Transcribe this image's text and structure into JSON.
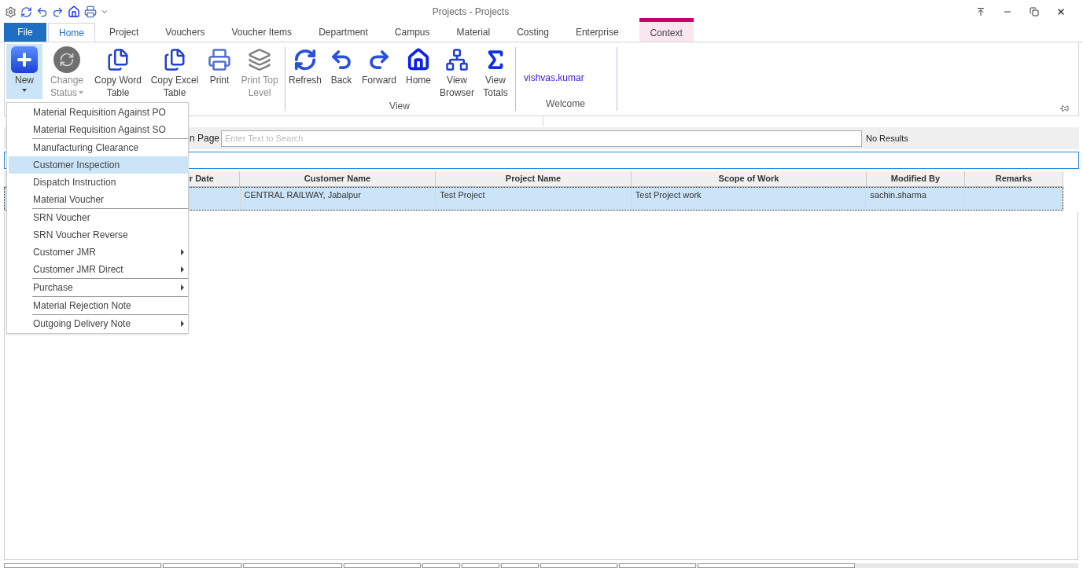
{
  "window": {
    "title": "Projects - Projects"
  },
  "tabs": [
    {
      "label": "File",
      "kind": "file",
      "selected": false
    },
    {
      "label": "Home",
      "kind": "tab",
      "selected": true
    },
    {
      "label": "Project",
      "kind": "tab",
      "selected": false
    },
    {
      "label": "Vouchers",
      "kind": "tab",
      "selected": false
    },
    {
      "label": "Voucher Items",
      "kind": "tab",
      "selected": false
    },
    {
      "label": "Department",
      "kind": "tab",
      "selected": false
    },
    {
      "label": "Campus",
      "kind": "tab",
      "selected": false
    },
    {
      "label": "Material",
      "kind": "tab",
      "selected": false
    },
    {
      "label": "Costing",
      "kind": "tab",
      "selected": false
    },
    {
      "label": "Enterprise",
      "kind": "tab",
      "selected": false
    },
    {
      "label": "Context",
      "kind": "context",
      "selected": false
    }
  ],
  "ribbon": {
    "groups": [
      {
        "buttons": [
          {
            "lines": [
              "New"
            ],
            "pressed": true,
            "disabled": false,
            "dropdown": true
          },
          {
            "lines": [
              "Change",
              "Status"
            ],
            "pressed": false,
            "disabled": true,
            "dropdown": true
          },
          {
            "lines": [
              "Copy Word",
              "Table"
            ],
            "pressed": false,
            "disabled": false,
            "dropdown": false
          },
          {
            "lines": [
              "Copy Excel",
              "Table"
            ],
            "pressed": false,
            "disabled": false,
            "dropdown": false
          },
          {
            "lines": [
              "Print"
            ],
            "pressed": false,
            "disabled": false,
            "dropdown": false
          },
          {
            "lines": [
              "Print Top",
              "Level"
            ],
            "pressed": false,
            "disabled": true,
            "dropdown": false
          }
        ]
      },
      {
        "label": "View",
        "buttons": [
          {
            "lines": [
              "Refresh"
            ],
            "pressed": false,
            "disabled": false,
            "dropdown": false
          },
          {
            "lines": [
              "Back"
            ],
            "pressed": false,
            "disabled": false,
            "dropdown": false
          },
          {
            "lines": [
              "Forward"
            ],
            "pressed": false,
            "disabled": false,
            "dropdown": false
          },
          {
            "lines": [
              "Home"
            ],
            "pressed": false,
            "disabled": false,
            "dropdown": false
          },
          {
            "lines": [
              "View",
              "Browser"
            ],
            "pressed": false,
            "disabled": false,
            "dropdown": false
          },
          {
            "lines": [
              "View",
              "Totals"
            ],
            "pressed": false,
            "disabled": false,
            "dropdown": false
          }
        ]
      },
      {
        "label": "Welcome",
        "user": "vishvas.kumar"
      }
    ]
  },
  "search": {
    "label": "n Page",
    "placeholder": "Enter Text to Search",
    "results": "No Results"
  },
  "table": {
    "columns": [
      "r Date",
      "Customer Name",
      "Project Name",
      "Scope of Work",
      "Modified By",
      "Remarks"
    ],
    "rows": [
      {
        "selected": true,
        "cells": [
          "",
          "CENTRAL RAILWAY, Jabalpur",
          "Test Project",
          "Test Project work",
          "sachin.sharma",
          ""
        ]
      }
    ]
  },
  "menu": {
    "groups": [
      {
        "items": [
          {
            "label": "Material Requisition Against PO",
            "selected": false,
            "submenu": false
          },
          {
            "label": "Material Requisition Against SO",
            "selected": false,
            "submenu": false
          }
        ]
      },
      {
        "items": [
          {
            "label": "Manufacturing Clearance",
            "selected": false,
            "submenu": false
          },
          {
            "label": "Customer Inspection",
            "selected": true,
            "submenu": false
          },
          {
            "label": "Dispatch Instruction",
            "selected": false,
            "submenu": false
          },
          {
            "label": "Material Voucher",
            "selected": false,
            "submenu": false
          }
        ]
      },
      {
        "items": [
          {
            "label": "SRN Voucher",
            "selected": false,
            "submenu": false
          },
          {
            "label": "SRN Voucher Reverse",
            "selected": false,
            "submenu": false
          },
          {
            "label": "Customer JMR",
            "selected": false,
            "submenu": true
          },
          {
            "label": "Customer JMR Direct",
            "selected": false,
            "submenu": true
          }
        ]
      },
      {
        "items": [
          {
            "label": "Purchase",
            "selected": false,
            "submenu": true
          }
        ]
      },
      {
        "items": [
          {
            "label": "Material Rejection Note",
            "selected": false,
            "submenu": false
          }
        ]
      },
      {
        "items": [
          {
            "label": "Outgoing Delivery Note",
            "selected": false,
            "submenu": true
          }
        ]
      }
    ]
  }
}
